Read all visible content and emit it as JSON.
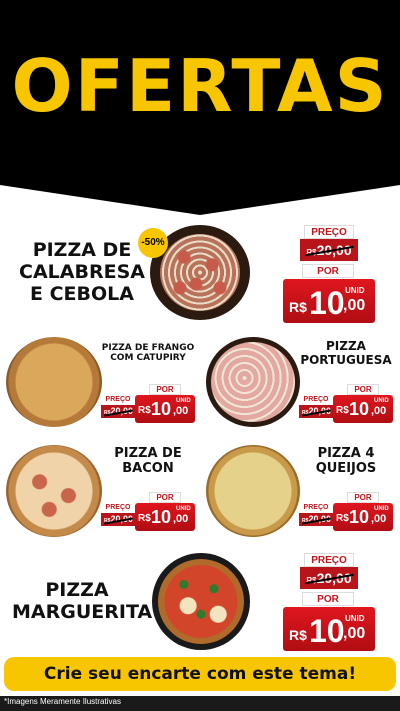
{
  "header": {
    "title": "OFERTAS"
  },
  "featured": [
    {
      "name_lines": [
        "PIZZA DE",
        "CALABRESA",
        "E CEBOLA"
      ],
      "badge": "-50%",
      "preco_label": "PREÇO",
      "old_currency": "R$",
      "old_price": "20,00",
      "por_label": "POR",
      "currency": "R$",
      "price_int": "10",
      "price_dec": ",00",
      "unit": "UNID"
    },
    {
      "name_lines": [
        "PIZZA",
        "MARGUERITA"
      ],
      "preco_label": "PREÇO",
      "old_currency": "R$",
      "old_price": "20,00",
      "por_label": "POR",
      "currency": "R$",
      "price_int": "10",
      "price_dec": ",00",
      "unit": "UNID"
    }
  ],
  "grid": [
    {
      "name_lines": [
        "PIZZA DE FRANGO",
        "COM CATUPIRY"
      ],
      "preco_label": "PREÇO",
      "old_currency": "R$",
      "old_price": "20,00",
      "por_label": "POR",
      "currency": "R$",
      "price_int": "10",
      "price_dec": ",00",
      "unit": "UNID"
    },
    {
      "name_lines": [
        "PIZZA",
        "PORTUGUESA"
      ],
      "preco_label": "PREÇO",
      "old_currency": "R$",
      "old_price": "20,00",
      "por_label": "POR",
      "currency": "R$",
      "price_int": "10",
      "price_dec": ",00",
      "unit": "UNID"
    },
    {
      "name_lines": [
        "PIZZA DE",
        "BACON"
      ],
      "preco_label": "PREÇO",
      "old_currency": "R$",
      "old_price": "20,00",
      "por_label": "POR",
      "currency": "R$",
      "price_int": "10",
      "price_dec": ",00",
      "unit": "UNID"
    },
    {
      "name_lines": [
        "PIZZA 4",
        "QUEIJOS"
      ],
      "preco_label": "PREÇO",
      "old_currency": "R$",
      "old_price": "20,00",
      "por_label": "POR",
      "currency": "R$",
      "price_int": "10",
      "price_dec": ",00",
      "unit": "UNID"
    }
  ],
  "cta": {
    "label": "Crie seu encarte com este tema!"
  },
  "footer": {
    "disclaimer": "*Imagens Meramente Ilustrativas"
  },
  "colors": {
    "yellow": "#f7c600",
    "red": "#c4161c",
    "black": "#000000"
  }
}
